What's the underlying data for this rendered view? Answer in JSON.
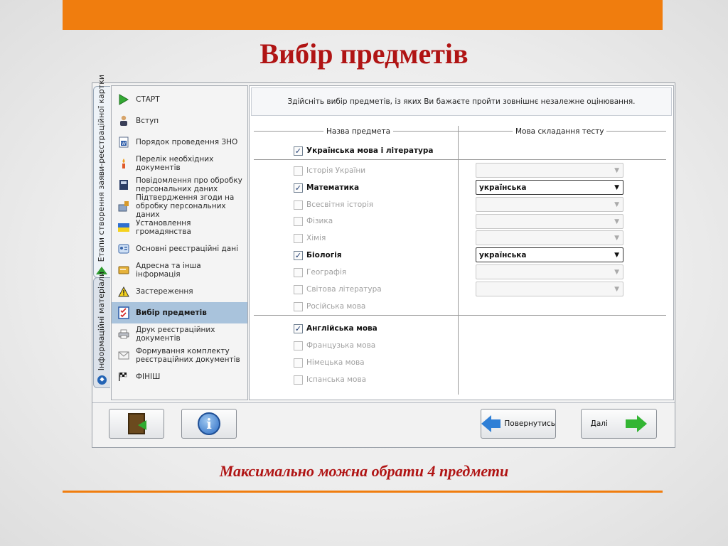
{
  "slide": {
    "title": "Вибір предметів",
    "caption": "Максимально можна обрати 4 предмети"
  },
  "colors": {
    "accent_orange": "#f07d0e",
    "title_red": "#b01414",
    "active_item": "#a9c3dc"
  },
  "tabs": {
    "stages": "Етапи створення заяви-реєстраційної картки",
    "info": "Інформаційні матеріали"
  },
  "sidebar": {
    "items": [
      {
        "label": "СТАРТ",
        "icon": "play-icon"
      },
      {
        "label": "Вступ",
        "icon": "person-icon"
      },
      {
        "label": "Порядок проведення ЗНО",
        "icon": "word-doc-icon"
      },
      {
        "label": "Перелік необхідних документів",
        "icon": "candle-icon"
      },
      {
        "label": "Повідомлення про обробку персональних даних",
        "icon": "book-icon"
      },
      {
        "label": "Підтвердження згоди на обробку персональних даних",
        "icon": "stamp-icon"
      },
      {
        "label": "Установлення громадянства",
        "icon": "flag-icon"
      },
      {
        "label": "Основні реєстраційні дані",
        "icon": "id-card-icon"
      },
      {
        "label": "Адресна та інша інформація",
        "icon": "address-book-icon"
      },
      {
        "label": "Застереження",
        "icon": "warning-icon"
      },
      {
        "label": "Вибір предметів",
        "icon": "checklist-icon"
      },
      {
        "label": "Друк реєстраційних документів",
        "icon": "printer-icon"
      },
      {
        "label": "Формування комплекту реєстраційних документів",
        "icon": "envelope-icon"
      },
      {
        "label": "ФІНІШ",
        "icon": "finish-flag-icon"
      }
    ]
  },
  "main": {
    "instruction": "Здійсніть вибір предметів, із яких Ви бажаєте пройти зовнішнє незалежне оцінювання.",
    "col_subject": "Назва предмета",
    "col_language": "Мова складання тесту",
    "mandatory": {
      "label": "Українська мова і література",
      "checked": true
    },
    "subjects": [
      {
        "label": "Історія України",
        "checked": false,
        "lang": ""
      },
      {
        "label": "Математика",
        "checked": true,
        "lang": "українська"
      },
      {
        "label": "Всесвітня історія",
        "checked": false,
        "lang": ""
      },
      {
        "label": "Фізика",
        "checked": false,
        "lang": ""
      },
      {
        "label": "Хімія",
        "checked": false,
        "lang": ""
      },
      {
        "label": "Біологія",
        "checked": true,
        "lang": "українська"
      },
      {
        "label": "Географія",
        "checked": false,
        "lang": ""
      },
      {
        "label": "Світова література",
        "checked": false,
        "lang": ""
      },
      {
        "label": "Російська мова",
        "checked": false
      }
    ],
    "foreign": [
      {
        "label": "Англійська мова",
        "checked": true
      },
      {
        "label": "Французька мова",
        "checked": false
      },
      {
        "label": "Німецька мова",
        "checked": false
      },
      {
        "label": "Іспанська мова",
        "checked": false
      }
    ]
  },
  "footer": {
    "back_label": "Повернутись",
    "next_label": "Далі",
    "exit_icon": "exit-door-icon",
    "info_icon": "info-icon"
  }
}
